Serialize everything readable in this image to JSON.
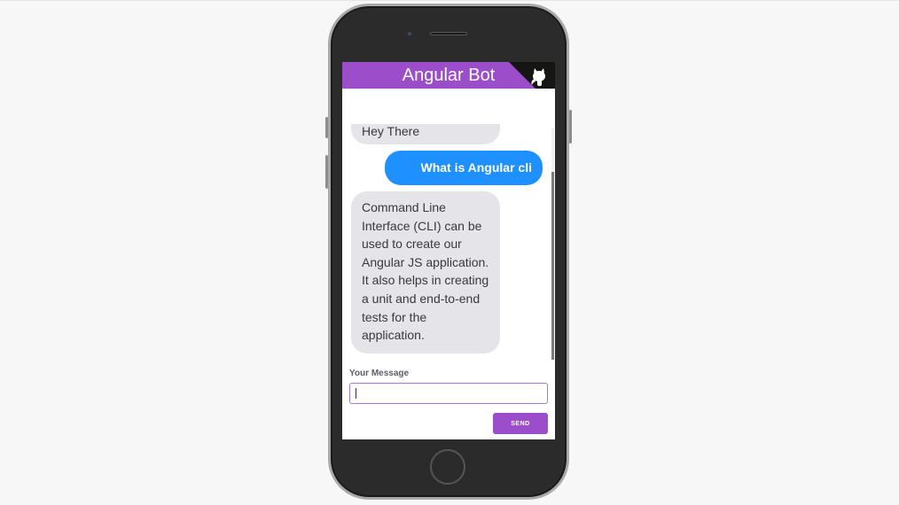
{
  "app": {
    "title": "Angular Bot"
  },
  "colors": {
    "header": "#9b4dca",
    "user_bubble": "#1e90ff",
    "bot_bubble": "#e4e4e9",
    "send_button": "#9b4dca"
  },
  "icons": {
    "corner": "github-octocat-icon"
  },
  "messages": [
    {
      "sender": "bot",
      "text": "Hey There"
    },
    {
      "sender": "user",
      "text": "What is Angular cli"
    },
    {
      "sender": "bot",
      "text": "Command Line Interface (CLI) can be used to create our Angular JS application. It also helps in creating a unit and end-to-end tests for the application."
    }
  ],
  "composer": {
    "label": "Your Message",
    "value": "",
    "placeholder": "",
    "send_label": "SEND"
  }
}
